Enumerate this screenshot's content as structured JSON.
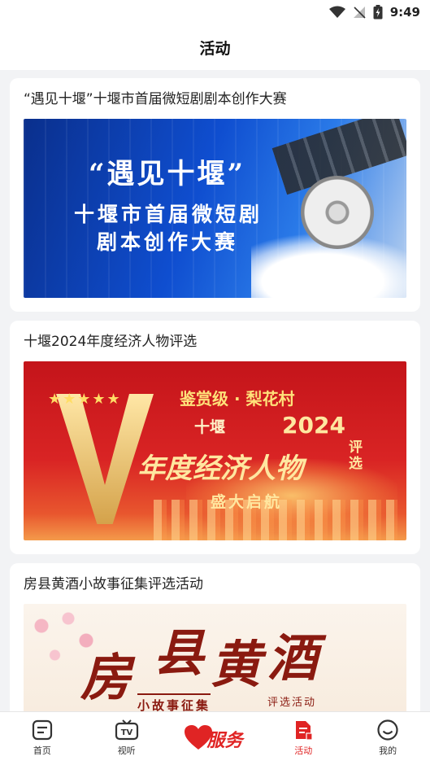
{
  "status_bar": {
    "time": "9:49"
  },
  "header": {
    "title": "活动"
  },
  "activities": [
    {
      "title": "“遇见十堰”十堰市首届微短剧剧本创作大赛",
      "banner": {
        "line1": "“遇见十堰”",
        "line2": "十堰市首届微短剧",
        "line3": "剧本创作大赛"
      }
    },
    {
      "title": "十堰2024年度经济人物评选",
      "banner": {
        "sponsor": "鉴赏级 · 梨花村",
        "place": "十堰",
        "year": "2024",
        "headline": "年度经济人物",
        "pick": "评选",
        "launch": "盛大启航"
      }
    },
    {
      "title": "房县黄酒小故事征集评选活动",
      "banner": {
        "c1": "房",
        "c2": "县",
        "c3": "黄",
        "c4": "酒",
        "sub": "小故事征集",
        "sub2": "评选活动"
      }
    }
  ],
  "tabs": [
    {
      "label": "首页",
      "icon": "home-icon"
    },
    {
      "label": "视听",
      "icon": "tv-icon"
    },
    {
      "label": "服务",
      "icon": "heart-icon"
    },
    {
      "label": "活动",
      "icon": "document-icon",
      "active": true
    },
    {
      "label": "我的",
      "icon": "smile-icon"
    }
  ],
  "colors": {
    "accent": "#e02424",
    "background": "#f2f3f5"
  }
}
